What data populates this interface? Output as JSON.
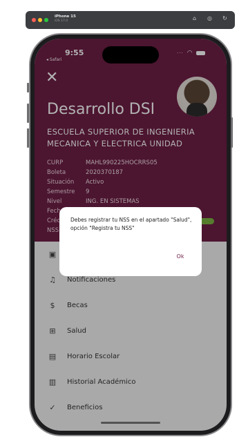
{
  "simulator": {
    "device_name": "iPhone 15",
    "device_sub": "iOS 17.0",
    "icons": [
      "home-icon",
      "screenshot-icon",
      "rotate-icon"
    ]
  },
  "status_bar": {
    "time": "9:55",
    "back_app": "◂ Safari"
  },
  "header": {
    "close_icon": "close-icon",
    "title": "Desarrollo DSI",
    "school": "ESCUELA SUPERIOR DE INGENIERIA MECANICA Y ELECTRICA UNIDAD",
    "background_color": "#6e1f45",
    "info": [
      {
        "label": "CURP",
        "value": "MAHL990225HOCRRS05"
      },
      {
        "label": "Boleta",
        "value": "2020370187"
      },
      {
        "label": "Situación",
        "value": "Activo"
      },
      {
        "label": "Semestre",
        "value": "9"
      },
      {
        "label": "Nivel",
        "value": "ING. EN SISTEMAS"
      },
      {
        "label": "Fecha",
        "value": ""
      },
      {
        "label": "Créd",
        "value": ""
      },
      {
        "label": "NSS",
        "value": ""
      }
    ]
  },
  "menu": {
    "items": [
      {
        "label": "",
        "icon": "id-card-icon"
      },
      {
        "label": "Notificaciones",
        "icon": "bell-icon"
      },
      {
        "label": "Becas",
        "icon": "dollar-icon"
      },
      {
        "label": "Salud",
        "icon": "plus-square-icon"
      },
      {
        "label": "Horario Escolar",
        "icon": "calendar-icon"
      },
      {
        "label": "Historial Académico",
        "icon": "history-icon"
      },
      {
        "label": "Beneficios",
        "icon": "benefits-icon"
      }
    ]
  },
  "dialog": {
    "message": "Debes registrar tu NSS en el apartado \"Salud\", opción \"Registra tu NSS\"",
    "ok_label": "Ok"
  }
}
